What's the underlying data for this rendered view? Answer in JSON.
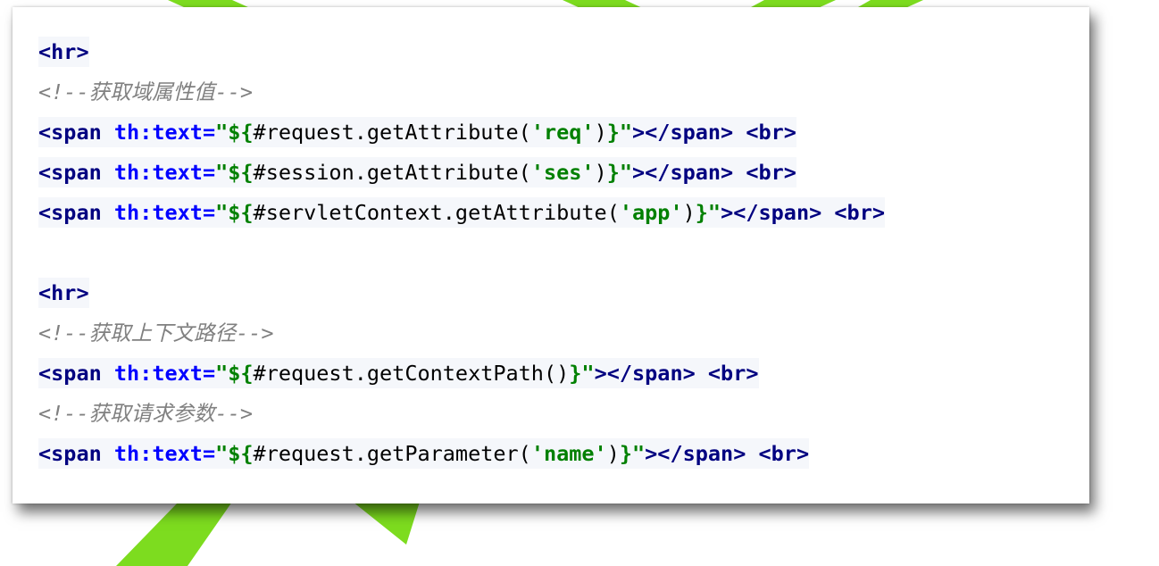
{
  "code_lines": [
    {
      "kind": "code",
      "tokens": [
        {
          "type": "tag",
          "text": "<hr>"
        }
      ]
    },
    {
      "kind": "comment",
      "tokens": [
        {
          "type": "comment",
          "text": "<!--获取域属性值-->"
        }
      ]
    },
    {
      "kind": "code",
      "tokens": [
        {
          "type": "tag",
          "text": "<span"
        },
        {
          "type": "punct",
          "text": " "
        },
        {
          "type": "attr",
          "text": "th:text="
        },
        {
          "type": "str",
          "text": "\"${"
        },
        {
          "type": "punct",
          "text": "#request.getAttribute("
        },
        {
          "type": "str",
          "text": "'req'"
        },
        {
          "type": "punct",
          "text": ")"
        },
        {
          "type": "str",
          "text": "}\""
        },
        {
          "type": "tag",
          "text": "></span>"
        },
        {
          "type": "punct",
          "text": " "
        },
        {
          "type": "tag",
          "text": "<br>"
        }
      ]
    },
    {
      "kind": "code",
      "tokens": [
        {
          "type": "tag",
          "text": "<span"
        },
        {
          "type": "punct",
          "text": " "
        },
        {
          "type": "attr",
          "text": "th:text="
        },
        {
          "type": "str",
          "text": "\"${"
        },
        {
          "type": "punct",
          "text": "#session.getAttribute("
        },
        {
          "type": "str",
          "text": "'ses'"
        },
        {
          "type": "punct",
          "text": ")"
        },
        {
          "type": "str",
          "text": "}\""
        },
        {
          "type": "tag",
          "text": "></span>"
        },
        {
          "type": "punct",
          "text": " "
        },
        {
          "type": "tag",
          "text": "<br>"
        }
      ]
    },
    {
      "kind": "code",
      "tokens": [
        {
          "type": "tag",
          "text": "<span"
        },
        {
          "type": "punct",
          "text": " "
        },
        {
          "type": "attr",
          "text": "th:text="
        },
        {
          "type": "str",
          "text": "\"${"
        },
        {
          "type": "punct",
          "text": "#servletContext.getAttribute("
        },
        {
          "type": "str",
          "text": "'app'"
        },
        {
          "type": "punct",
          "text": ")"
        },
        {
          "type": "str",
          "text": "}\""
        },
        {
          "type": "tag",
          "text": "></span>"
        },
        {
          "type": "punct",
          "text": " "
        },
        {
          "type": "tag",
          "text": "<br>"
        }
      ]
    },
    {
      "kind": "blank",
      "tokens": []
    },
    {
      "kind": "code",
      "tokens": [
        {
          "type": "tag",
          "text": "<hr>"
        }
      ]
    },
    {
      "kind": "comment",
      "tokens": [
        {
          "type": "comment",
          "text": "<!--获取上下文路径-->"
        }
      ]
    },
    {
      "kind": "code",
      "tokens": [
        {
          "type": "tag",
          "text": "<span"
        },
        {
          "type": "punct",
          "text": " "
        },
        {
          "type": "attr",
          "text": "th:text="
        },
        {
          "type": "str",
          "text": "\"${"
        },
        {
          "type": "punct",
          "text": "#request.getContextPath()"
        },
        {
          "type": "str",
          "text": "}\""
        },
        {
          "type": "tag",
          "text": "></span>"
        },
        {
          "type": "punct",
          "text": " "
        },
        {
          "type": "tag",
          "text": "<br>"
        }
      ]
    },
    {
      "kind": "comment",
      "tokens": [
        {
          "type": "comment",
          "text": "<!--获取请求参数-->"
        }
      ]
    },
    {
      "kind": "code",
      "tokens": [
        {
          "type": "tag",
          "text": "<span"
        },
        {
          "type": "punct",
          "text": " "
        },
        {
          "type": "attr",
          "text": "th:text="
        },
        {
          "type": "str",
          "text": "\"${"
        },
        {
          "type": "punct",
          "text": "#request.getParameter("
        },
        {
          "type": "str",
          "text": "'name'"
        },
        {
          "type": "punct",
          "text": ")"
        },
        {
          "type": "str",
          "text": "}\""
        },
        {
          "type": "tag",
          "text": "></span>"
        },
        {
          "type": "punct",
          "text": " "
        },
        {
          "type": "tag",
          "text": "<br>"
        }
      ]
    }
  ],
  "colors": {
    "tag": "#000080",
    "attr": "#0000ff",
    "string": "#008000",
    "comment": "#808080",
    "highlight": "#f5f7fb",
    "background_stroke": "#7ddc1f"
  }
}
